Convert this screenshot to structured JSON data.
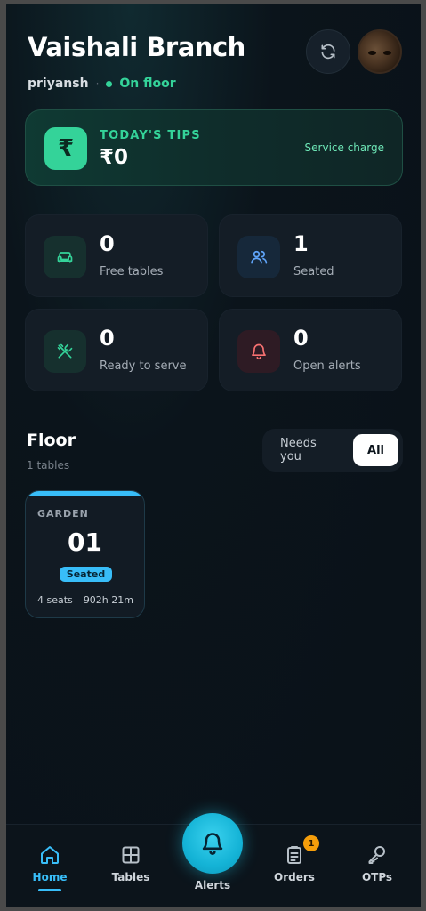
{
  "header": {
    "title": "Vaishali Branch",
    "user": "priyansh",
    "separator": "·",
    "status": "On floor"
  },
  "tips": {
    "currency_symbol": "₹",
    "label": "TODAY'S TIPS",
    "value": "₹0",
    "right_label": "Service charge"
  },
  "stats": [
    {
      "value": "0",
      "label": "Free tables"
    },
    {
      "value": "1",
      "label": "Seated"
    },
    {
      "value": "0",
      "label": "Ready to serve"
    },
    {
      "value": "0",
      "label": "Open alerts"
    }
  ],
  "floor": {
    "title": "Floor",
    "count": "1 tables",
    "filter_options": [
      "Needs you",
      "All"
    ],
    "selected_filter": "All"
  },
  "tables": [
    {
      "zone": "GARDEN",
      "number": "01",
      "status": "Seated",
      "seats": "4 seats",
      "elapsed": "902h 21m"
    }
  ],
  "nav": {
    "home": "Home",
    "tables": "Tables",
    "alerts": "Alerts",
    "orders": "Orders",
    "orders_badge": "1",
    "otps": "OTPs"
  },
  "colors": {
    "accent_green": "#34d399",
    "accent_blue": "#38bdf8",
    "alert_red": "#f87171",
    "badge_orange": "#f59e0b"
  },
  "icons": [
    "refresh-icon",
    "rupee-icon",
    "sofa-icon",
    "users-icon",
    "utensils-crossed-icon",
    "bell-icon",
    "home-icon",
    "grid-icon",
    "clipboard-icon",
    "key-icon"
  ]
}
